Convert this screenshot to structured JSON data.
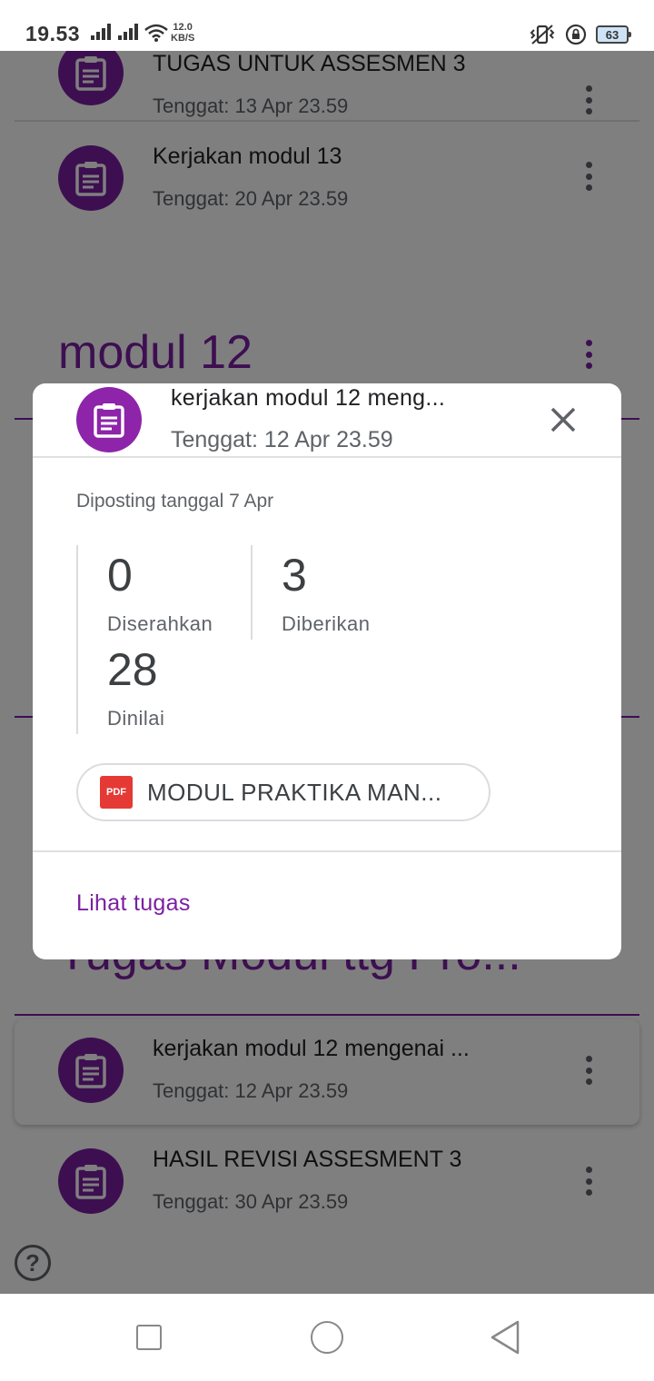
{
  "status_bar": {
    "time": "19.53",
    "net_speed_value": "12.0",
    "net_speed_unit": "KB/S",
    "battery": "63"
  },
  "list": {
    "items": [
      {
        "title": "TUGAS UNTUK ASSESMEN 3",
        "due": "Tenggat: 13 Apr 23.59"
      },
      {
        "title": "Kerjakan modul 13",
        "due": "Tenggat: 20 Apr 23.59"
      },
      {
        "title": "kerjakan modul 12 mengenai ...",
        "due": "Tenggat: 12 Apr 23.59"
      },
      {
        "title": "HASIL REVISI ASSESMENT 3",
        "due": "Tenggat: 30 Apr 23.59"
      }
    ],
    "topics": [
      "modul 12",
      "Tugas Modul ttg Pro..."
    ]
  },
  "dialog": {
    "title": "kerjakan modul 12 meng...",
    "due": "Tenggat: 12 Apr 23.59",
    "posted": "Diposting tanggal 7 Apr",
    "stats": {
      "submitted_count": "0",
      "submitted_label": "Diserahkan",
      "assigned_count": "3",
      "assigned_label": "Diberikan",
      "graded_count": "28",
      "graded_label": "Dinilai"
    },
    "attachment": {
      "type_label": "PDF",
      "name": "MODUL PRAKTIKA MAN..."
    },
    "action_label": "Lihat tugas"
  },
  "colors": {
    "accent": "#7b1fa2",
    "pdf": "#e53935"
  }
}
